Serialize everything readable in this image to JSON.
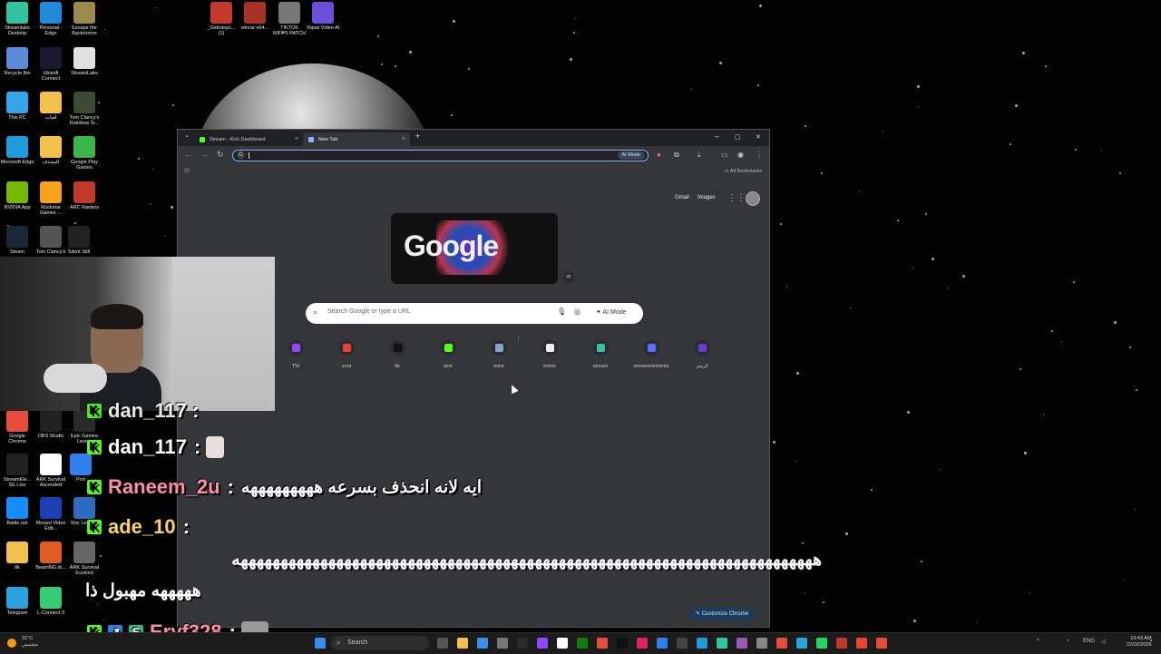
{
  "desktop_icons": [
    {
      "label": "Streamlabs Desktop",
      "color": "#31c3a2"
    },
    {
      "label": "Personal - Edge",
      "color": "#1f8ad9"
    },
    {
      "label": "Escape the Backrooms",
      "color": "#9b8a4a"
    },
    {
      "label": "Recycle Bin",
      "color": "#5a8bd6"
    },
    {
      "label": "Ubisoft Connect",
      "color": "#1a1a2e"
    },
    {
      "label": "StreamLabs",
      "color": "#e0e0e0"
    },
    {
      "label": "This PC",
      "color": "#35a4e8"
    },
    {
      "label": "لعبات",
      "color": "#f2c04c"
    },
    {
      "label": "Tom Clancy's Rainbow Si...",
      "color": "#3d4a33"
    },
    {
      "label": "Microsoft Edge",
      "color": "#1e9bd8"
    },
    {
      "label": "للمحذف",
      "color": "#f2c04c"
    },
    {
      "label": "Google Play Games",
      "color": "#3bb54a"
    },
    {
      "label": "NVIDIA App",
      "color": "#76b900"
    },
    {
      "label": "Rockstar Games ...",
      "color": "#f4a11c"
    },
    {
      "label": "ARC Raiders",
      "color": "#c0392b"
    },
    {
      "label": "Steam",
      "color": "#1b2838"
    },
    {
      "label": "Tom Clancy's",
      "color": "#555"
    },
    {
      "label": "Silent Still",
      "color": "#222"
    },
    {
      "label": "_Getintopc... (1)",
      "color": "#c0392b"
    },
    {
      "label": "winrar-x64...",
      "color": "#a93226"
    },
    {
      "label": "TIKTOK 60FPS PATCH",
      "color": "#777"
    },
    {
      "label": "Topaz Video AI",
      "color": "#6b4fd8"
    },
    {
      "label": "Google Chrome",
      "color": "#e74c3c"
    },
    {
      "label": "OBS Studio",
      "color": "#222"
    },
    {
      "label": "Epic Games Laun...",
      "color": "#2b2b2b"
    },
    {
      "label": "StreamEle... SE.Live",
      "color": "#222"
    },
    {
      "label": "ARK Survival Ascended",
      "color": "#ffffff"
    },
    {
      "label": "Port",
      "color": "#2f80ed"
    },
    {
      "label": "Battle.net",
      "color": "#148eff"
    },
    {
      "label": "Movavi Video Edit...",
      "color": "#1b3fb5"
    },
    {
      "label": "Roc League",
      "color": "#2d6cc0"
    },
    {
      "label": "tik",
      "color": "#f2c04c"
    },
    {
      "label": "BeamNG.dr...",
      "color": "#e05a23"
    },
    {
      "label": "ARK Survival Evolved",
      "color": "#666"
    },
    {
      "label": "Telegram",
      "color": "#2aa3de"
    },
    {
      "label": "L-Connect 3",
      "color": "#3c7"
    }
  ],
  "browser": {
    "tabs": [
      {
        "title": "Stream - Kick Dashboard",
        "favicon_color": "#53fc18",
        "active": false
      },
      {
        "title": "New Tab",
        "favicon_color": "#8ab4f8",
        "active": true
      }
    ],
    "new_tab_symbol": "+",
    "window_controls": {
      "minimize": "–",
      "maximize": "▢",
      "close": "✕"
    },
    "address_value": "",
    "ai_mode_pill": "AI Mode",
    "all_bookmarks": "All Bookmarks",
    "links": {
      "gmail": "Gmail",
      "images": "Images"
    },
    "doodle_text": "Google",
    "search_placeholder": "Search Google or type a URL",
    "search_ai_mode": "AI Mode",
    "shortcuts": [
      {
        "label": "TW",
        "color": "#9146ff"
      },
      {
        "label": "yout",
        "color": "#ea4335"
      },
      {
        "label": "tik",
        "color": "#111"
      },
      {
        "label": "kick",
        "color": "#53fc18"
      },
      {
        "label": "mine",
        "color": "#8aa4c8"
      },
      {
        "label": "botrix",
        "color": "#eee"
      },
      {
        "label": "stream",
        "color": "#31c3a2"
      },
      {
        "label": "streamelements",
        "color": "#5b6cff"
      },
      {
        "label": "كريتيز",
        "color": "#6b3ad8"
      }
    ],
    "customize_label": "Customize Chrome"
  },
  "chat": [
    {
      "user": "dan_117",
      "user_color": "#ffffff",
      "message": "",
      "badges": 1
    },
    {
      "user": "Raneem_2u",
      "user_color": "#ff8fa6",
      "message": "ايه لانه انحذف بسرعه هههههههههه",
      "badges": 1
    },
    {
      "user": "ade_10",
      "user_color": "#f7d56b",
      "message": "",
      "badges": 1
    },
    {
      "user": "Eryf328",
      "user_color": "#ff8fa6",
      "message": "",
      "badges": 3
    }
  ],
  "chat_long_text": "هههههههههههههههههههههههههههههههههههههههههههههههههههههههههههههههههههههههههه",
  "chat_long_text_2": "هههههه مهبول ذا",
  "chat_top_partial": "dan_117 :",
  "taskbar": {
    "weather_temp": "31°C",
    "weather_desc": "مشمس",
    "search_label": "Search",
    "time": "10:43 AM",
    "date": "22/02/2026",
    "tray_lang": "ENG"
  }
}
